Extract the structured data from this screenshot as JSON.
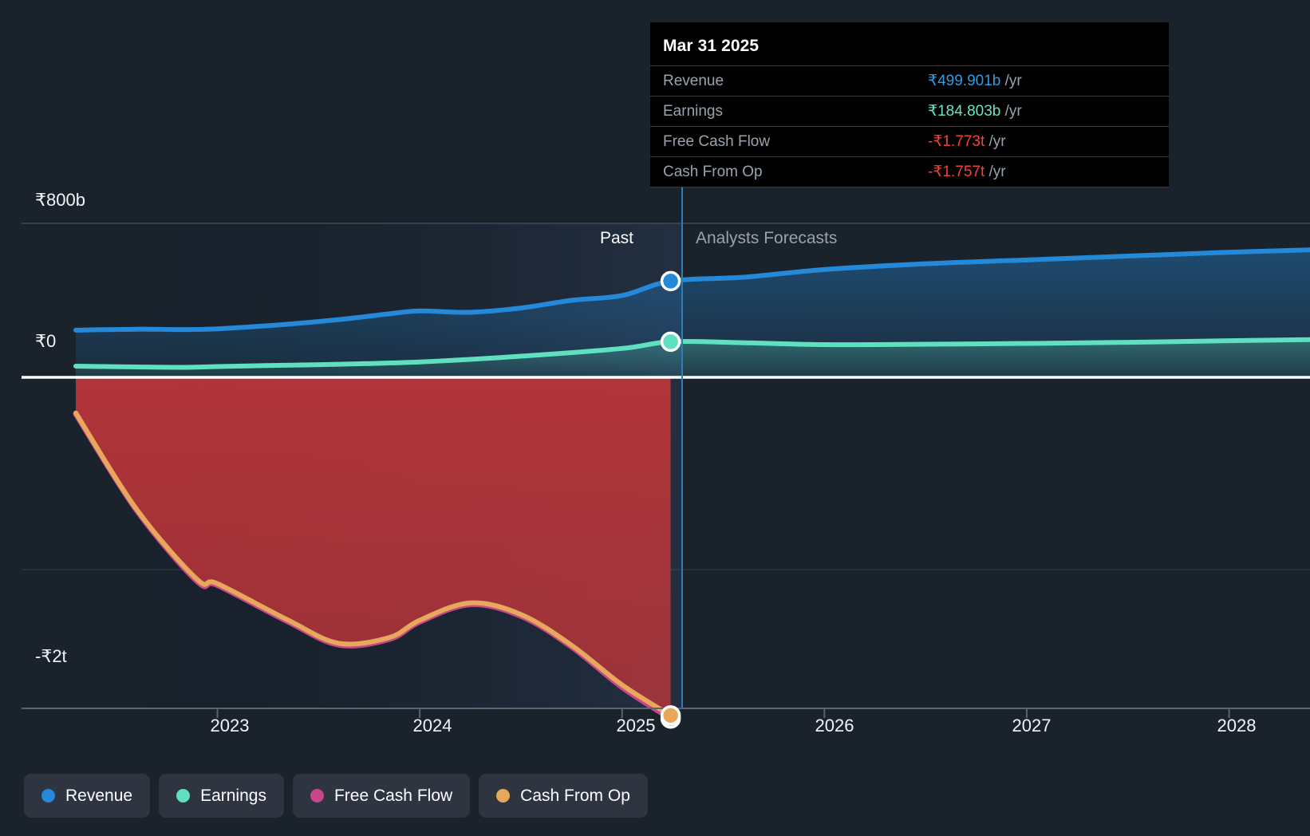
{
  "tooltip": {
    "title": "Mar 31 2025",
    "rows": [
      {
        "label": "Revenue",
        "value": "₹499.901b",
        "suffix": " /yr",
        "color": "#2f9be0"
      },
      {
        "label": "Earnings",
        "value": "₹184.803b",
        "suffix": " /yr",
        "color": "#69e3c4"
      },
      {
        "label": "Free Cash Flow",
        "value": "-₹1.773t",
        "suffix": " /yr",
        "color": "#f0433a"
      },
      {
        "label": "Cash From Op",
        "value": "-₹1.757t",
        "suffix": " /yr",
        "color": "#f0433a"
      }
    ]
  },
  "zones": {
    "past_label": "Past",
    "forecast_label": "Analysts Forecasts"
  },
  "legend": [
    {
      "label": "Revenue",
      "color": "#2489d8"
    },
    {
      "label": "Earnings",
      "color": "#5fe0c0"
    },
    {
      "label": "Free Cash Flow",
      "color": "#c9468c"
    },
    {
      "label": "Cash From Op",
      "color": "#e8a85c"
    }
  ],
  "chart_data": {
    "type": "area",
    "title": "",
    "xlabel": "",
    "ylabel": "",
    "currency": "INR",
    "grid": true,
    "legend_position": "bottom-left",
    "divider_x_label": "Mar 31 2025",
    "y_ticks": [
      {
        "label": "₹800b",
        "value": 800
      },
      {
        "label": "₹0",
        "value": 0
      },
      {
        "label": "-₹2t",
        "value": -2000
      }
    ],
    "ylim": [
      -2000,
      800
    ],
    "x_ticks": [
      "2023",
      "2024",
      "2025",
      "2026",
      "2027",
      "2028"
    ],
    "xlim": [
      "2022.3",
      "2028.4"
    ],
    "units": "billions of INR per year",
    "series": [
      {
        "name": "Revenue",
        "color": "#2489d8",
        "x": [
          2022.3,
          2022.6,
          2022.85,
          2023.0,
          2023.3,
          2023.6,
          2023.85,
          2024.0,
          2024.25,
          2024.5,
          2024.75,
          2025.0,
          2025.24,
          2025.6,
          2026.0,
          2026.5,
          2027.0,
          2027.5,
          2028.0,
          2028.4
        ],
        "values": [
          245,
          250,
          248,
          252,
          272,
          300,
          330,
          345,
          338,
          360,
          400,
          425,
          500,
          520,
          560,
          590,
          610,
          630,
          650,
          662
        ]
      },
      {
        "name": "Earnings",
        "color": "#5fe0c0",
        "x": [
          2022.3,
          2022.6,
          2022.85,
          2023.0,
          2023.3,
          2023.6,
          2024.0,
          2024.5,
          2025.0,
          2025.24,
          2025.6,
          2026.0,
          2026.5,
          2027.0,
          2027.5,
          2028.0,
          2028.4
        ],
        "values": [
          58,
          54,
          52,
          56,
          62,
          68,
          80,
          110,
          150,
          185,
          180,
          170,
          172,
          176,
          182,
          190,
          196
        ]
      },
      {
        "name": "Free Cash Flow",
        "color": "#c9468c",
        "x": [
          2022.3,
          2022.6,
          2022.9,
          2023.0,
          2023.35,
          2023.6,
          2023.85,
          2024.0,
          2024.25,
          2024.5,
          2024.75,
          2025.0,
          2025.24
        ],
        "values": [
          -190,
          -690,
          -1060,
          -1080,
          -1270,
          -1390,
          -1360,
          -1270,
          -1180,
          -1240,
          -1400,
          -1610,
          -1773
        ]
      },
      {
        "name": "Cash From Op",
        "color": "#e8a85c",
        "x": [
          2022.3,
          2022.6,
          2022.9,
          2023.0,
          2023.35,
          2023.6,
          2023.85,
          2024.0,
          2024.25,
          2024.5,
          2024.75,
          2025.0,
          2025.24
        ],
        "values": [
          -185,
          -685,
          -1050,
          -1072,
          -1262,
          -1382,
          -1352,
          -1262,
          -1172,
          -1232,
          -1392,
          -1598,
          -1757
        ]
      }
    ],
    "markers": [
      {
        "series": "Revenue",
        "x": 2025.24,
        "value": 499.901
      },
      {
        "series": "Earnings",
        "x": 2025.24,
        "value": 184.803
      },
      {
        "series": "Free Cash Flow",
        "x": 2025.24,
        "value": -1773
      },
      {
        "series": "Cash From Op",
        "x": 2025.24,
        "value": -1757
      }
    ]
  }
}
